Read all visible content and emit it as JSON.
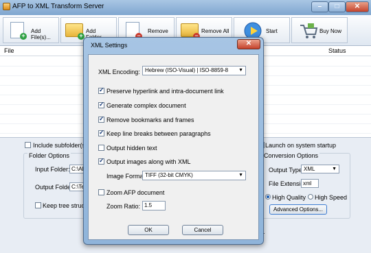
{
  "window": {
    "title": "AFP to XML Transform Server",
    "minimize": "–",
    "maximize": "□",
    "close": "✕"
  },
  "toolbar": {
    "add_files": "Add File(s)...",
    "add_folder": "Add Folder...",
    "remove": "Remove",
    "remove_all": "Remove All",
    "start": "Start",
    "buy_now": "Buy Now"
  },
  "list": {
    "col_file": "File",
    "col_status": "Status"
  },
  "options": {
    "include_subfolders": "Include subfolder(s)",
    "folder_options": "Folder Options",
    "input_folder_label": "Input Folder:",
    "input_folder_value": "C:\\AF",
    "output_folder_label": "Output Folder:",
    "output_folder_value": "C:\\Te",
    "keep_tree": "Keep tree structure",
    "launch_startup": "Launch on system startup",
    "conversion_options": "Conversion Options",
    "output_type_label": "Output Type:",
    "output_type_value": "XML",
    "file_ext_label": "File Extension:",
    "file_ext_value": "xml",
    "high_quality": "High Quality",
    "high_speed": "High Speed",
    "advanced": "Advanced Options...",
    "partial_text": "d."
  },
  "dialog": {
    "title": "XML Settings",
    "close": "✕",
    "encoding_label": "XML Encoding:",
    "encoding_value": "Hebrew (ISO-Visual) | ISO-8859-8",
    "checks": [
      {
        "label": "Preserve hyperlink and intra-document link",
        "checked": true
      },
      {
        "label": "Generate complex document",
        "checked": true
      },
      {
        "label": "Remove bookmarks and frames",
        "checked": true
      },
      {
        "label": "Keep line breaks between paragraphs",
        "checked": true
      },
      {
        "label": "Output hidden text",
        "checked": false
      },
      {
        "label": "Output images along with XML",
        "checked": true
      }
    ],
    "image_format_label": "Image Format:",
    "image_format_value": "TIFF (32-bit CMYK)",
    "zoom_doc": "Zoom AFP document",
    "zoom_ratio_label": "Zoom Ratio:",
    "zoom_ratio_value": "1.5",
    "ok": "OK",
    "cancel": "Cancel"
  }
}
